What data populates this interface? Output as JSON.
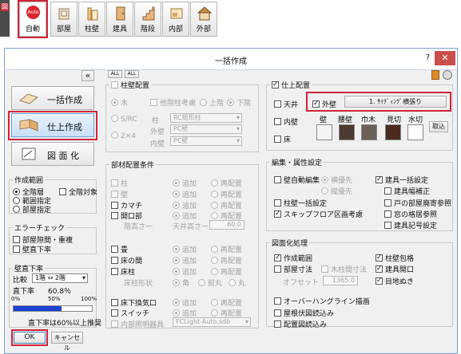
{
  "toolbar": {
    "side_glyph": "図",
    "buttons": [
      {
        "label": "自動",
        "badge": "Auto",
        "icon": "auto-icon"
      },
      {
        "label": "部屋",
        "icon": "room-icon"
      },
      {
        "label": "柱壁",
        "icon": "column-wall-icon"
      },
      {
        "label": "建具",
        "icon": "fitting-icon"
      },
      {
        "label": "階段",
        "icon": "stairs-icon"
      },
      {
        "label": "内部",
        "icon": "interior-icon"
      },
      {
        "label": "外部",
        "icon": "exterior-icon"
      }
    ]
  },
  "dialog": {
    "title": "一括作成",
    "help": "?",
    "close": "✕",
    "collapse": "«",
    "allon": "ALL",
    "alloff": "ALL",
    "modes": [
      {
        "label": "一括作成",
        "icon": "batch-create-icon"
      },
      {
        "label": "仕上作成",
        "icon": "finish-create-icon"
      },
      {
        "label": "図 面 化",
        "icon": "drawing-icon"
      }
    ],
    "range": {
      "title": "作成範囲",
      "all_floors": "全階層",
      "all_targets": "全階対象",
      "range_spec": "範囲指定",
      "room_spec": "部屋指定"
    },
    "error_check": {
      "title": "エラーチェック",
      "room_gap": "部屋隙間・重複",
      "wall_direct": "壁直下率"
    },
    "wall_rate": {
      "title": "壁直下率",
      "compare_label": "比較",
      "compare_value": "1階 ⇔ 2階",
      "rate_label": "直下率",
      "rate_value": "60.8％",
      "ticks": [
        "0%",
        "50%",
        "100%"
      ],
      "progress": 0.608,
      "note": "直下率は60%以上推奨"
    },
    "ok": "OK",
    "cancel": "キャンセル",
    "column": {
      "title": "柱壁配置",
      "wood": "木",
      "other_floor": "他階柱考慮",
      "upper": "上階",
      "lower": "下階",
      "src": "S/RC",
      "col_label": "柱",
      "col_value": "RC矩形柱",
      "two_by_four": "2×4",
      "ext_wall_label": "外壁",
      "ext_wall_value": "PC壁",
      "int_wall_label": "内壁",
      "int_wall_value": "PC壁"
    },
    "members": {
      "title": "部材配置条件",
      "add": "追加",
      "replace": "再配置",
      "column": "柱",
      "wall": "壁",
      "kamachi": "カマチ",
      "opening": "開口部",
      "eave_height_label": "階高さ一",
      "ceiling_label": "天井高さ一",
      "ceiling_value": "60.0",
      "tatami": "畳",
      "tokonoma": "床の間",
      "tokobashira": "床柱",
      "toko_shape_label": "床柱形状",
      "shape_square": "角",
      "shape_chamfer": "前丸",
      "shape_round": "丸",
      "underfloor": "床下換気口",
      "switch": "スイッチ",
      "lighting": "内部照明器具",
      "lighting_value": "FCLight-Auto.sdb"
    },
    "finish": {
      "title": "仕上配置",
      "ceiling": "天井",
      "exterior": "外壁",
      "exterior_value": "1. ｻｲﾃﾞｨﾝｸﾞ横張り",
      "interior": "内壁",
      "floor": "床",
      "swatch_headers": [
        "壁",
        "腰壁",
        "巾木",
        "見切",
        "水切"
      ],
      "swatch_colors": [
        "#f5f5f5",
        "#4a3a32",
        "#6b6055",
        "#4a2a1e",
        "#ffffff"
      ],
      "pick_button": "取込"
    },
    "edit": {
      "title": "編集・属性設定",
      "auto_wall_edit": "壁自動編集",
      "horizontal": "横優先",
      "vertical": "縦優先",
      "batch_fitting": "建具一括設定",
      "fitting_width": "建具幅補正",
      "column_wall_set": "柱壁一括設定",
      "room_ref": "戸の部屋廃寄参照",
      "skip_floor": "スキップフロア区画考慮",
      "window_ref": "窓の格居参照",
      "fitting_code": "建具記号設定"
    },
    "drawing": {
      "title": "図面化処理",
      "create_range": "作成範囲",
      "column_outline": "柱壁包格",
      "room_dim": "部屋寸法",
      "wood_dim": "木柱間寸法",
      "fitting_opening": "建具開口",
      "offset_label": "オフセット",
      "offset_value": "1365.0",
      "ground_line": "目地ぬき",
      "overhang": "オーバーハングライン描画",
      "roof_plan": "屋根伏図読込み",
      "layout_plan": "配置図読込み"
    }
  }
}
